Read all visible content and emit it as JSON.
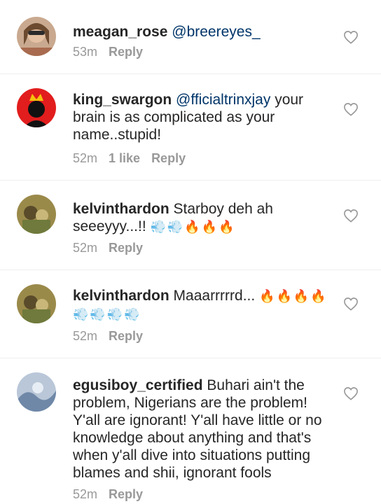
{
  "comments": [
    {
      "username": "meagan_rose",
      "mention": "@breereyes_",
      "text": "",
      "emojis": "",
      "time": "53m",
      "likes": "",
      "reply": "Reply"
    },
    {
      "username": "king_swargon",
      "mention": "@fficialtrinxjay",
      "text": " your brain is as complicated as your name..stupid!",
      "emojis": "",
      "time": "52m",
      "likes": "1 like",
      "reply": "Reply"
    },
    {
      "username": "kelvinthardon",
      "mention": "",
      "text": " Starboy deh ah seeeyyy...!!",
      "emojis": "💨💨🔥🔥🔥",
      "time": "52m",
      "likes": "",
      "reply": "Reply"
    },
    {
      "username": "kelvinthardon",
      "mention": "",
      "text": " Maaarrrrrd...",
      "emojis": "🔥🔥🔥🔥 💨💨💨💨",
      "time": "52m",
      "likes": "",
      "reply": "Reply"
    },
    {
      "username": "egusiboy_certified",
      "mention": "",
      "text": " Buhari ain't the problem, Nigerians are the problem! Y'all are ignorant! Y'all have little or no knowledge about anything and that's when y'all dive into situations putting blames and shii, ignorant fools",
      "emojis": "",
      "time": "52m",
      "likes": "",
      "reply": "Reply"
    }
  ],
  "icons": {
    "heart": "heart-outline-icon"
  }
}
